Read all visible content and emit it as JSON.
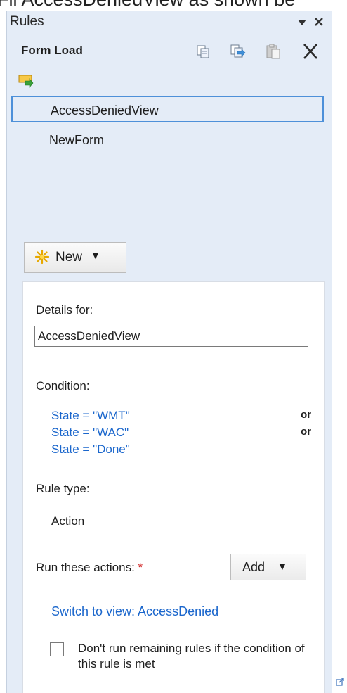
{
  "top_caption": "Fil AccessDeniedView as shown be",
  "pane": {
    "title": "Rules",
    "menu_icon": "dropdown-triangle-icon",
    "close_icon": "close-icon"
  },
  "header": {
    "title": "Form Load",
    "toolbar_icons": [
      "copy-icon",
      "copy-rule-icon",
      "paste-icon",
      "delete-icon"
    ]
  },
  "rules_list": {
    "group_icon": "form-load-rule-icon",
    "items": [
      {
        "label": "AccessDeniedView",
        "selected": true
      },
      {
        "label": "NewForm",
        "selected": false
      }
    ]
  },
  "new_button": {
    "label": "New",
    "icon": "sparkle-icon"
  },
  "details": {
    "details_for_label": "Details for:",
    "name_value": "AccessDeniedView",
    "condition_label": "Condition:",
    "conditions": [
      {
        "text": "State = \"WMT\"",
        "conjunction": "or"
      },
      {
        "text": "State = \"WAC\"",
        "conjunction": "or"
      },
      {
        "text": "State = \"Done\"",
        "conjunction": ""
      }
    ],
    "rule_type_label": "Rule type:",
    "rule_type_value": "Action",
    "run_actions_label": "Run these actions:",
    "required_mark": "*",
    "add_button_label": "Add",
    "actions": [
      "Switch to view: AccessDenied"
    ],
    "checkbox_label": "Don't run remaining rules if the condition of this rule is met",
    "checkbox_checked": false
  },
  "colors": {
    "pane_bg": "#e4ecf7",
    "link": "#1a66cc",
    "selection_border": "#4d90d9",
    "required": "#d02020"
  }
}
